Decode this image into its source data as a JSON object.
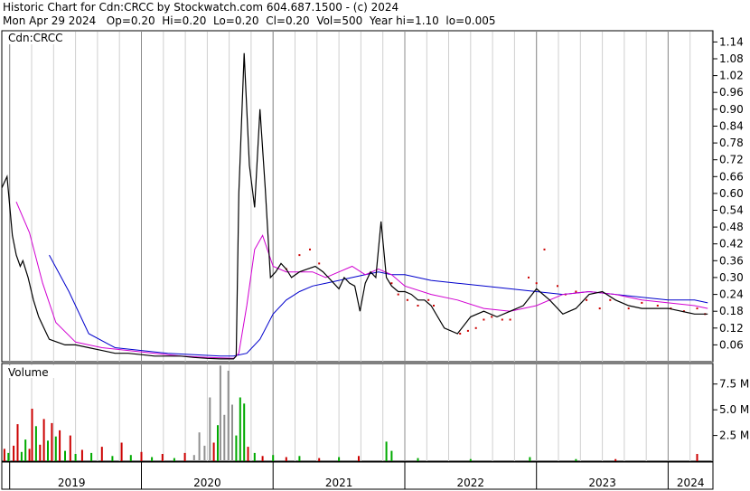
{
  "header": {
    "line1": "Historic Chart for Cdn:CRCC by Stockwatch.com 604.687.1500 - (c) 2024",
    "line2": "Mon Apr 29 2024   Op=0.20  Hi=0.20  Lo=0.20  Cl=0.20  Vol=500  Year hi=1.10  lo=0.005"
  },
  "chart_data": [
    {
      "type": "line",
      "panel": "price",
      "title": "Cdn:CRCC",
      "ylim": [
        0.0,
        1.18
      ],
      "yticks": [
        "1.14",
        "1.08",
        "1.02",
        "0.96",
        "0.90",
        "0.84",
        "0.78",
        "0.72",
        "0.66",
        "0.60",
        "0.54",
        "0.48",
        "0.42",
        "0.36",
        "0.30",
        "0.24",
        "0.18",
        "0.12",
        "0.06"
      ],
      "x_years": [
        "2019",
        "2020",
        "2021",
        "2022",
        "2023",
        "2024"
      ],
      "x_range": [
        2018.94,
        2024.34
      ],
      "year_boundaries": [
        2019.0,
        2020.0,
        2021.0,
        2022.0,
        2023.0,
        2024.0
      ],
      "series": [
        {
          "key": "price",
          "color": "#000000",
          "x": [
            2018.94,
            2018.98,
            2019.02,
            2019.05,
            2019.08,
            2019.1,
            2019.14,
            2019.18,
            2019.22,
            2019.26,
            2019.3,
            2019.36,
            2019.42,
            2019.5,
            2019.6,
            2019.7,
            2019.8,
            2019.9,
            2020.0,
            2020.1,
            2020.2,
            2020.3,
            2020.4,
            2020.5,
            2020.6,
            2020.65,
            2020.7,
            2020.72,
            2020.74,
            2020.78,
            2020.82,
            2020.86,
            2020.9,
            2020.94,
            2020.98,
            2021.02,
            2021.06,
            2021.1,
            2021.14,
            2021.2,
            2021.26,
            2021.32,
            2021.38,
            2021.42,
            2021.46,
            2021.5,
            2021.54,
            2021.58,
            2021.62,
            2021.66,
            2021.7,
            2021.74,
            2021.78,
            2021.82,
            2021.86,
            2021.9,
            2021.95,
            2022.0,
            2022.05,
            2022.1,
            2022.15,
            2022.2,
            2022.3,
            2022.4,
            2022.5,
            2022.6,
            2022.7,
            2022.8,
            2022.9,
            2023.0,
            2023.1,
            2023.2,
            2023.3,
            2023.4,
            2023.5,
            2023.6,
            2023.7,
            2023.8,
            2023.9,
            2024.0,
            2024.1,
            2024.2,
            2024.3
          ],
          "y": [
            0.62,
            0.66,
            0.45,
            0.38,
            0.34,
            0.36,
            0.3,
            0.22,
            0.16,
            0.12,
            0.08,
            0.07,
            0.06,
            0.06,
            0.05,
            0.04,
            0.03,
            0.03,
            0.025,
            0.02,
            0.02,
            0.02,
            0.015,
            0.012,
            0.01,
            0.01,
            0.01,
            0.02,
            0.6,
            1.1,
            0.7,
            0.55,
            0.9,
            0.62,
            0.3,
            0.32,
            0.35,
            0.33,
            0.3,
            0.32,
            0.33,
            0.34,
            0.32,
            0.3,
            0.28,
            0.26,
            0.3,
            0.28,
            0.27,
            0.18,
            0.28,
            0.32,
            0.3,
            0.5,
            0.3,
            0.27,
            0.25,
            0.25,
            0.24,
            0.22,
            0.22,
            0.2,
            0.12,
            0.1,
            0.16,
            0.18,
            0.16,
            0.18,
            0.2,
            0.26,
            0.22,
            0.17,
            0.19,
            0.24,
            0.25,
            0.22,
            0.2,
            0.19,
            0.19,
            0.19,
            0.18,
            0.17,
            0.17
          ]
        },
        {
          "key": "ma_fast",
          "color": "#d100d1",
          "x": [
            2019.05,
            2019.15,
            2019.25,
            2019.35,
            2019.5,
            2019.7,
            2019.9,
            2020.1,
            2020.3,
            2020.5,
            2020.7,
            2020.74,
            2020.8,
            2020.86,
            2020.92,
            2021.0,
            2021.1,
            2021.2,
            2021.3,
            2021.4,
            2021.5,
            2021.6,
            2021.7,
            2021.8,
            2021.9,
            2022.0,
            2022.2,
            2022.4,
            2022.6,
            2022.8,
            2023.0,
            2023.2,
            2023.4,
            2023.6,
            2023.8,
            2024.0,
            2024.2,
            2024.3
          ],
          "y": [
            0.57,
            0.46,
            0.28,
            0.14,
            0.07,
            0.05,
            0.04,
            0.03,
            0.02,
            0.015,
            0.012,
            0.03,
            0.2,
            0.4,
            0.45,
            0.34,
            0.32,
            0.32,
            0.32,
            0.3,
            0.32,
            0.34,
            0.31,
            0.33,
            0.31,
            0.27,
            0.24,
            0.22,
            0.19,
            0.18,
            0.2,
            0.24,
            0.25,
            0.24,
            0.22,
            0.21,
            0.2,
            0.19
          ]
        },
        {
          "key": "ma_slow",
          "color": "#0000cc",
          "x": [
            2019.3,
            2019.45,
            2019.6,
            2019.8,
            2020.0,
            2020.2,
            2020.4,
            2020.6,
            2020.7,
            2020.8,
            2020.9,
            2021.0,
            2021.1,
            2021.2,
            2021.3,
            2021.4,
            2021.5,
            2021.6,
            2021.7,
            2021.8,
            2021.9,
            2022.0,
            2022.2,
            2022.4,
            2022.6,
            2022.8,
            2023.0,
            2023.2,
            2023.4,
            2023.6,
            2023.8,
            2024.0,
            2024.2,
            2024.3
          ],
          "y": [
            0.38,
            0.25,
            0.1,
            0.05,
            0.04,
            0.03,
            0.025,
            0.02,
            0.02,
            0.03,
            0.08,
            0.17,
            0.22,
            0.25,
            0.27,
            0.28,
            0.29,
            0.3,
            0.31,
            0.32,
            0.31,
            0.31,
            0.29,
            0.28,
            0.27,
            0.26,
            0.25,
            0.24,
            0.25,
            0.24,
            0.23,
            0.22,
            0.22,
            0.21
          ]
        }
      ],
      "red_dots": {
        "color": "#cc0000",
        "x": [
          2021.1,
          2021.2,
          2021.28,
          2021.35,
          2021.9,
          2021.95,
          2022.02,
          2022.1,
          2022.18,
          2022.22,
          2022.42,
          2022.48,
          2022.54,
          2022.6,
          2022.66,
          2022.74,
          2022.8,
          2022.94,
          2023.0,
          2023.06,
          2023.16,
          2023.22,
          2023.3,
          2023.38,
          2023.48,
          2023.56,
          2023.7,
          2023.8,
          2023.92,
          2024.02,
          2024.12,
          2024.22,
          2024.28
        ],
        "y": [
          0.33,
          0.38,
          0.4,
          0.35,
          0.28,
          0.24,
          0.22,
          0.2,
          0.22,
          0.2,
          0.1,
          0.11,
          0.12,
          0.15,
          0.16,
          0.15,
          0.15,
          0.3,
          0.28,
          0.4,
          0.27,
          0.24,
          0.25,
          0.22,
          0.19,
          0.22,
          0.19,
          0.21,
          0.2,
          0.19,
          0.18,
          0.19,
          0.17
        ]
      }
    },
    {
      "type": "bar",
      "panel": "volume",
      "title": "Volume",
      "ylim": [
        0,
        9.5
      ],
      "yticks": [
        "7.5 M",
        "5.0 M",
        "2.5 M"
      ],
      "up_color": "#00aa00",
      "down_color": "#cc0000",
      "neutral_color": "#909090",
      "bars": [
        {
          "x": 2018.96,
          "v": 1.2,
          "c": "d"
        },
        {
          "x": 2018.99,
          "v": 0.8,
          "c": "u"
        },
        {
          "x": 2019.03,
          "v": 1.5,
          "c": "d"
        },
        {
          "x": 2019.06,
          "v": 3.6,
          "c": "d"
        },
        {
          "x": 2019.09,
          "v": 0.9,
          "c": "u"
        },
        {
          "x": 2019.12,
          "v": 2.1,
          "c": "u"
        },
        {
          "x": 2019.15,
          "v": 1.2,
          "c": "d"
        },
        {
          "x": 2019.17,
          "v": 5.1,
          "c": "d"
        },
        {
          "x": 2019.2,
          "v": 3.4,
          "c": "u"
        },
        {
          "x": 2019.23,
          "v": 1.6,
          "c": "d"
        },
        {
          "x": 2019.26,
          "v": 4.1,
          "c": "d"
        },
        {
          "x": 2019.29,
          "v": 2.0,
          "c": "u"
        },
        {
          "x": 2019.32,
          "v": 3.7,
          "c": "d"
        },
        {
          "x": 2019.35,
          "v": 2.4,
          "c": "u"
        },
        {
          "x": 2019.38,
          "v": 3.0,
          "c": "d"
        },
        {
          "x": 2019.42,
          "v": 1.0,
          "c": "u"
        },
        {
          "x": 2019.46,
          "v": 2.5,
          "c": "d"
        },
        {
          "x": 2019.5,
          "v": 0.7,
          "c": "u"
        },
        {
          "x": 2019.55,
          "v": 1.1,
          "c": "d"
        },
        {
          "x": 2019.62,
          "v": 0.8,
          "c": "u"
        },
        {
          "x": 2019.7,
          "v": 1.4,
          "c": "d"
        },
        {
          "x": 2019.78,
          "v": 0.5,
          "c": "u"
        },
        {
          "x": 2019.85,
          "v": 1.8,
          "c": "d"
        },
        {
          "x": 2019.92,
          "v": 0.6,
          "c": "u"
        },
        {
          "x": 2020.0,
          "v": 0.9,
          "c": "d"
        },
        {
          "x": 2020.08,
          "v": 0.4,
          "c": "u"
        },
        {
          "x": 2020.16,
          "v": 0.7,
          "c": "d"
        },
        {
          "x": 2020.25,
          "v": 0.3,
          "c": "u"
        },
        {
          "x": 2020.33,
          "v": 0.8,
          "c": "d"
        },
        {
          "x": 2020.4,
          "v": 0.6,
          "c": "n"
        },
        {
          "x": 2020.44,
          "v": 2.8,
          "c": "n"
        },
        {
          "x": 2020.48,
          "v": 1.5,
          "c": "n"
        },
        {
          "x": 2020.52,
          "v": 6.2,
          "c": "n"
        },
        {
          "x": 2020.55,
          "v": 1.8,
          "c": "d"
        },
        {
          "x": 2020.58,
          "v": 3.5,
          "c": "u"
        },
        {
          "x": 2020.6,
          "v": 9.3,
          "c": "n"
        },
        {
          "x": 2020.63,
          "v": 4.5,
          "c": "n"
        },
        {
          "x": 2020.66,
          "v": 8.8,
          "c": "n"
        },
        {
          "x": 2020.69,
          "v": 5.5,
          "c": "n"
        },
        {
          "x": 2020.72,
          "v": 2.5,
          "c": "u"
        },
        {
          "x": 2020.75,
          "v": 6.2,
          "c": "u"
        },
        {
          "x": 2020.78,
          "v": 5.6,
          "c": "u"
        },
        {
          "x": 2020.81,
          "v": 1.4,
          "c": "d"
        },
        {
          "x": 2020.86,
          "v": 0.8,
          "c": "u"
        },
        {
          "x": 2020.92,
          "v": 0.5,
          "c": "d"
        },
        {
          "x": 2021.0,
          "v": 0.6,
          "c": "u"
        },
        {
          "x": 2021.1,
          "v": 0.4,
          "c": "d"
        },
        {
          "x": 2021.2,
          "v": 0.5,
          "c": "u"
        },
        {
          "x": 2021.35,
          "v": 0.3,
          "c": "d"
        },
        {
          "x": 2021.5,
          "v": 0.4,
          "c": "u"
        },
        {
          "x": 2021.65,
          "v": 0.5,
          "c": "d"
        },
        {
          "x": 2021.86,
          "v": 1.9,
          "c": "u"
        },
        {
          "x": 2021.9,
          "v": 1.0,
          "c": "u"
        },
        {
          "x": 2022.1,
          "v": 0.3,
          "c": "u"
        },
        {
          "x": 2022.5,
          "v": 0.2,
          "c": "u"
        },
        {
          "x": 2022.95,
          "v": 0.4,
          "c": "u"
        },
        {
          "x": 2023.3,
          "v": 0.2,
          "c": "u"
        },
        {
          "x": 2023.6,
          "v": 0.2,
          "c": "d"
        },
        {
          "x": 2024.22,
          "v": 0.7,
          "c": "d"
        }
      ]
    }
  ]
}
